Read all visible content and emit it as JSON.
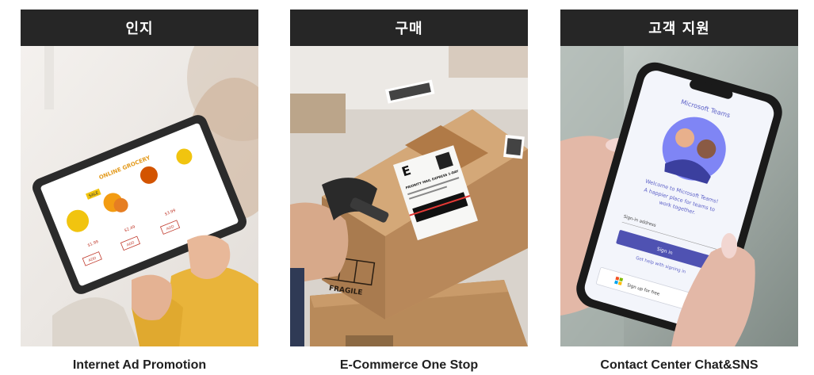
{
  "cards": [
    {
      "header": "인지",
      "caption": "Internet Ad Promotion",
      "screen": {
        "title": "ONLINE GROCERY",
        "sale_badge": "SALE",
        "price_1": "$1.99",
        "price_2": "$2.49",
        "price_3": "$3.99",
        "button": "ADD"
      }
    },
    {
      "header": "구매",
      "caption": "E-Commerce One Stop",
      "label": {
        "letter": "E",
        "line": "PRIORITY MAIL EXPRESS 1-DAY",
        "fragile": "FRAGILE"
      }
    },
    {
      "header": "고객 지원",
      "caption": "Contact Center Chat&SNS",
      "phone": {
        "app_title": "Microsoft Teams",
        "welcome": "Welcome to Microsoft Teams!",
        "tagline_1": "A happier place for teams to",
        "tagline_2": "work together.",
        "signin_label": "Sign-in address",
        "signin_button": "Sign in",
        "help_link": "Get help with signing in",
        "signup_button": "Sign up for free"
      }
    }
  ]
}
